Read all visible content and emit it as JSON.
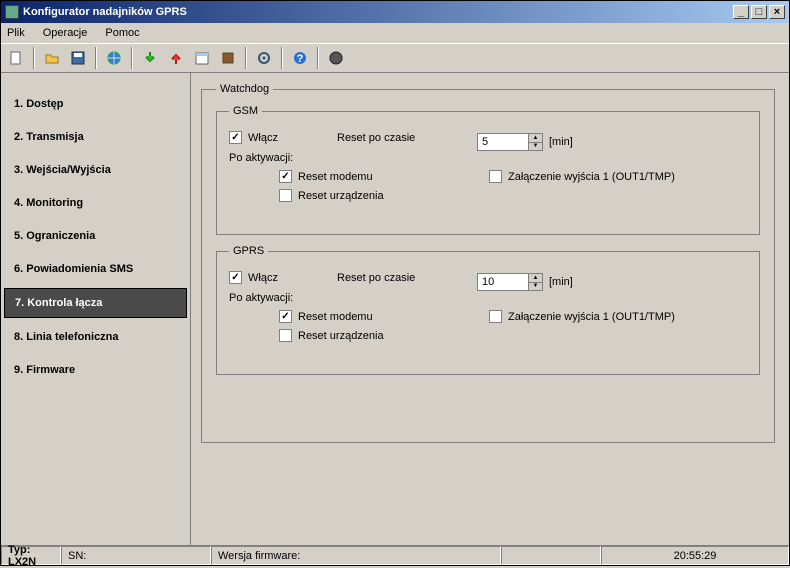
{
  "window": {
    "title": "Konfigurator nadajników GPRS"
  },
  "menu": {
    "file": "Plik",
    "operations": "Operacje",
    "help": "Pomoc"
  },
  "sidebar": {
    "items": [
      {
        "label": "1. Dostęp"
      },
      {
        "label": "2. Transmisja"
      },
      {
        "label": "3. Wejścia/Wyjścia"
      },
      {
        "label": "4. Monitoring"
      },
      {
        "label": "5. Ograniczenia"
      },
      {
        "label": "6. Powiadomienia SMS"
      },
      {
        "label": "7. Kontrola łącza"
      },
      {
        "label": "8. Linia telefoniczna"
      },
      {
        "label": "9. Firmware"
      }
    ],
    "active_index": 6
  },
  "watchdog": {
    "legend": "Watchdog",
    "gsm": {
      "legend": "GSM",
      "enable_label": "Włącz",
      "enable_checked": true,
      "reset_after_label": "Reset po czasie",
      "reset_after_value": "5",
      "reset_after_unit": "[min]",
      "post_activation_label": "Po aktywacji:",
      "reset_modem_label": "Reset modemu",
      "reset_modem_checked": true,
      "reset_device_label": "Reset urządzenia",
      "reset_device_checked": false,
      "out1_label": "Załączenie wyjścia 1 (OUT1/TMP)",
      "out1_checked": false
    },
    "gprs": {
      "legend": "GPRS",
      "enable_label": "Włącz",
      "enable_checked": true,
      "reset_after_label": "Reset po czasie",
      "reset_after_value": "10",
      "reset_after_unit": "[min]",
      "post_activation_label": "Po aktywacji:",
      "reset_modem_label": "Reset modemu",
      "reset_modem_checked": true,
      "reset_device_label": "Reset urządzenia",
      "reset_device_checked": false,
      "out1_label": "Załączenie wyjścia 1 (OUT1/TMP)",
      "out1_checked": false
    }
  },
  "status": {
    "type_label": "Typ: LX2N",
    "sn_label": "SN:",
    "fw_label": "Wersja firmware:",
    "time": "20:55:29"
  }
}
